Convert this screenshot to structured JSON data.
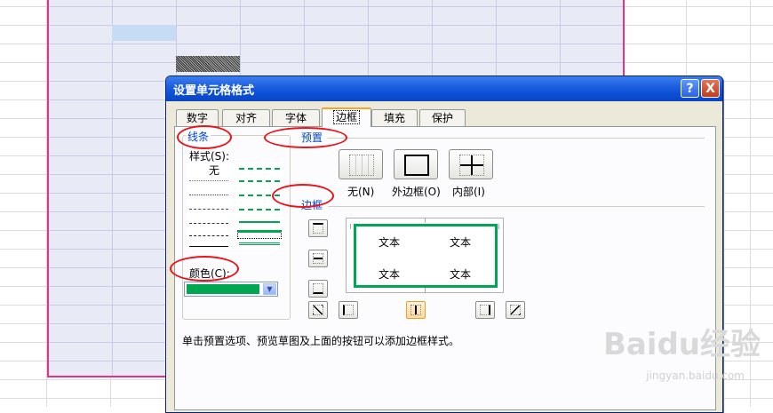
{
  "dialog": {
    "title": "设置单元格格式",
    "help": "?",
    "close": "X",
    "tabs": [
      {
        "label": "数字"
      },
      {
        "label": "对齐"
      },
      {
        "label": "字体"
      },
      {
        "label": "边框",
        "active": true
      },
      {
        "label": "填充"
      },
      {
        "label": "保护"
      }
    ]
  },
  "line_group": {
    "legend": "线条",
    "style_label": "样式(S):",
    "style_none": "无",
    "color_label": "颜色(C):",
    "selected_color": "#00a651"
  },
  "preset_group": {
    "legend": "预置",
    "none": "无(N)",
    "outline": "外边框(O)",
    "inside": "内部(I)"
  },
  "border_group": {
    "legend": "边框",
    "preview_texts": [
      "文本",
      "文本",
      "文本",
      "文本"
    ]
  },
  "hint": "单击预置选项、预览草图及上面的按钮可以添加边框样式。",
  "watermark": {
    "brand": "Baidu经验",
    "url": "jingyan.baidu.com"
  },
  "colors": {
    "accent": "#00a651",
    "annotation": "#e8141a",
    "range_border": "#ee2f8a",
    "title": "#0a4fd6"
  }
}
